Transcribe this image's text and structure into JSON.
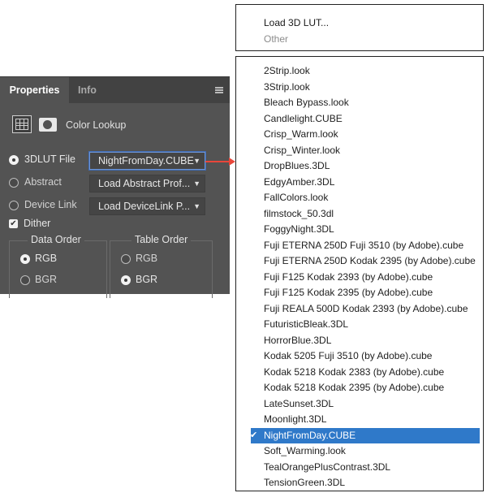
{
  "panel": {
    "tabs": [
      "Properties",
      "Info"
    ],
    "adjustment_title": "Color Lookup",
    "options": [
      {
        "label": "3DLUT File",
        "selected": true,
        "value": "NightFromDay.CUBE"
      },
      {
        "label": "Abstract",
        "selected": false,
        "value": "Load Abstract Prof..."
      },
      {
        "label": "Device Link",
        "selected": false,
        "value": "Load DeviceLink P..."
      }
    ],
    "dither": {
      "label": "Dither",
      "checked": true
    },
    "data_order": {
      "title": "Data Order",
      "options": [
        "RGB",
        "BGR"
      ],
      "selected": "RGB"
    },
    "table_order": {
      "title": "Table Order",
      "options": [
        "RGB",
        "BGR"
      ],
      "selected": "BGR"
    }
  },
  "top_menu": {
    "items": [
      "Load 3D LUT...",
      "Other"
    ]
  },
  "lut_list": {
    "items": [
      "2Strip.look",
      "3Strip.look",
      "Bleach Bypass.look",
      "Candlelight.CUBE",
      "Crisp_Warm.look",
      "Crisp_Winter.look",
      "DropBlues.3DL",
      "EdgyAmber.3DL",
      "FallColors.look",
      "filmstock_50.3dl",
      "FoggyNight.3DL",
      "Fuji ETERNA 250D Fuji 3510 (by Adobe).cube",
      "Fuji ETERNA 250D Kodak 2395 (by Adobe).cube",
      "Fuji F125 Kodak 2393 (by Adobe).cube",
      "Fuji F125 Kodak 2395 (by Adobe).cube",
      "Fuji REALA 500D Kodak 2393 (by Adobe).cube",
      "FuturisticBleak.3DL",
      "HorrorBlue.3DL",
      "Kodak 5205 Fuji 3510 (by Adobe).cube",
      "Kodak 5218 Kodak 2383 (by Adobe).cube",
      "Kodak 5218 Kodak 2395 (by Adobe).cube",
      "LateSunset.3DL",
      "Moonlight.3DL",
      "NightFromDay.CUBE",
      "Soft_Warming.look",
      "TealOrangePlusContrast.3DL",
      "TensionGreen.3DL"
    ],
    "selected": "NightFromDay.CUBE"
  },
  "colors": {
    "panel_bg": "#535353",
    "selection": "#2f79c9",
    "arrow": "#e8463a"
  }
}
